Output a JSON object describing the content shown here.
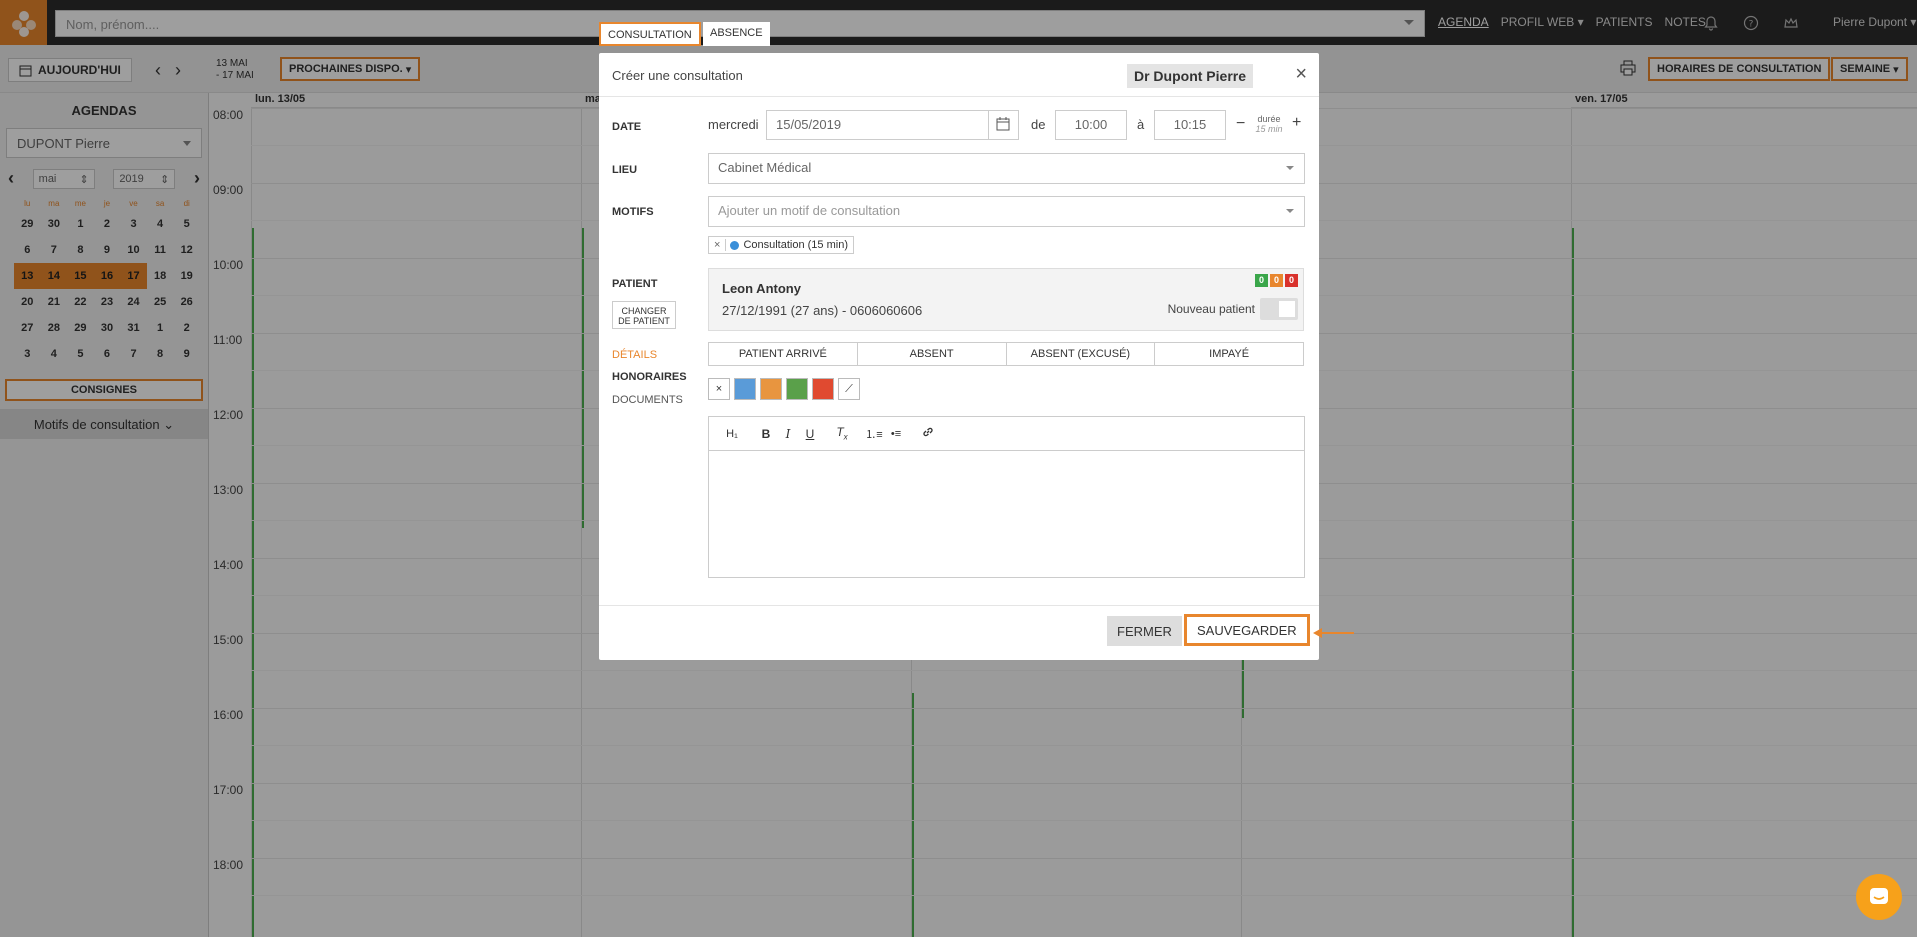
{
  "topbar": {
    "search_placeholder": "Nom, prénom....",
    "nav": [
      "AGENDA",
      "PROFIL WEB",
      "PATIENTS",
      "NOTES"
    ],
    "user": "Pierre Dupont"
  },
  "toolbar": {
    "today": "AUJOURD'HUI",
    "range_line1": "13 MAI",
    "range_line2": "- 17 MAI",
    "next_dispo": "PROCHAINES DISPO.",
    "horaires": "HORAIRES DE CONSULTATION",
    "view": "SEMAINE"
  },
  "sidebar": {
    "title": "AGENDAS",
    "agenda_select": "DUPONT Pierre",
    "month": "mai",
    "year": "2019",
    "weekdays": [
      "lu",
      "ma",
      "me",
      "je",
      "ve",
      "sa",
      "di"
    ],
    "weeks": [
      [
        "29",
        "30",
        "1",
        "2",
        "3",
        "4",
        "5"
      ],
      [
        "6",
        "7",
        "8",
        "9",
        "10",
        "11",
        "12"
      ],
      [
        "13",
        "14",
        "15",
        "16",
        "17",
        "18",
        "19"
      ],
      [
        "20",
        "21",
        "22",
        "23",
        "24",
        "25",
        "26"
      ],
      [
        "27",
        "28",
        "29",
        "30",
        "31",
        "1",
        "2"
      ],
      [
        "3",
        "4",
        "5",
        "6",
        "7",
        "8",
        "9"
      ]
    ],
    "consignes": "CONSIGNES",
    "motifs": "Motifs de consultation"
  },
  "calendar": {
    "columns": [
      "lun. 13/05",
      "ma",
      "",
      "",
      "ven. 17/05"
    ],
    "hours": [
      "08:00",
      "09:00",
      "10:00",
      "11:00",
      "12:00",
      "13:00",
      "14:00",
      "15:00",
      "16:00",
      "17:00",
      "18:00"
    ]
  },
  "modal": {
    "tabs": [
      "CONSULTATION",
      "ABSENCE"
    ],
    "title": "Créer une consultation",
    "doctor": "Dr Dupont Pierre",
    "date_label": "DATE",
    "weekday": "mercredi",
    "date_value": "15/05/2019",
    "de": "de",
    "start": "10:00",
    "a": "à",
    "end": "10:15",
    "duree": "durée",
    "duree_value": "15 min",
    "lieu_label": "LIEU",
    "lieu_value": "Cabinet Médical",
    "motifs_label": "MOTIFS",
    "motifs_placeholder": "Ajouter un motif de consultation",
    "motif_tag": "Consultation (15 min)",
    "patient_label": "PATIENT",
    "change_patient_1": "CHANGER",
    "change_patient_2": "DE PATIENT",
    "patient_name": "Leon Antony",
    "patient_info": "27/12/1991 (27 ans) - 0606060606",
    "badges": [
      "0",
      "0",
      "0"
    ],
    "nouveau_patient": "Nouveau patient",
    "statuses": [
      "PATIENT ARRIVÉ",
      "ABSENT",
      "ABSENT (EXCUSÉ)",
      "IMPAYÉ"
    ],
    "side_tabs": [
      "DÉTAILS",
      "HONORAIRES",
      "DOCUMENTS"
    ],
    "color_swatches": [
      "#5a9bd8",
      "#e8953f",
      "#5aa04a",
      "#e04a30"
    ],
    "fermer": "FERMER",
    "sauvegarder": "SAUVEGARDER"
  },
  "colors": {
    "accent": "#e8862d",
    "topbar": "#2d2d2d"
  }
}
